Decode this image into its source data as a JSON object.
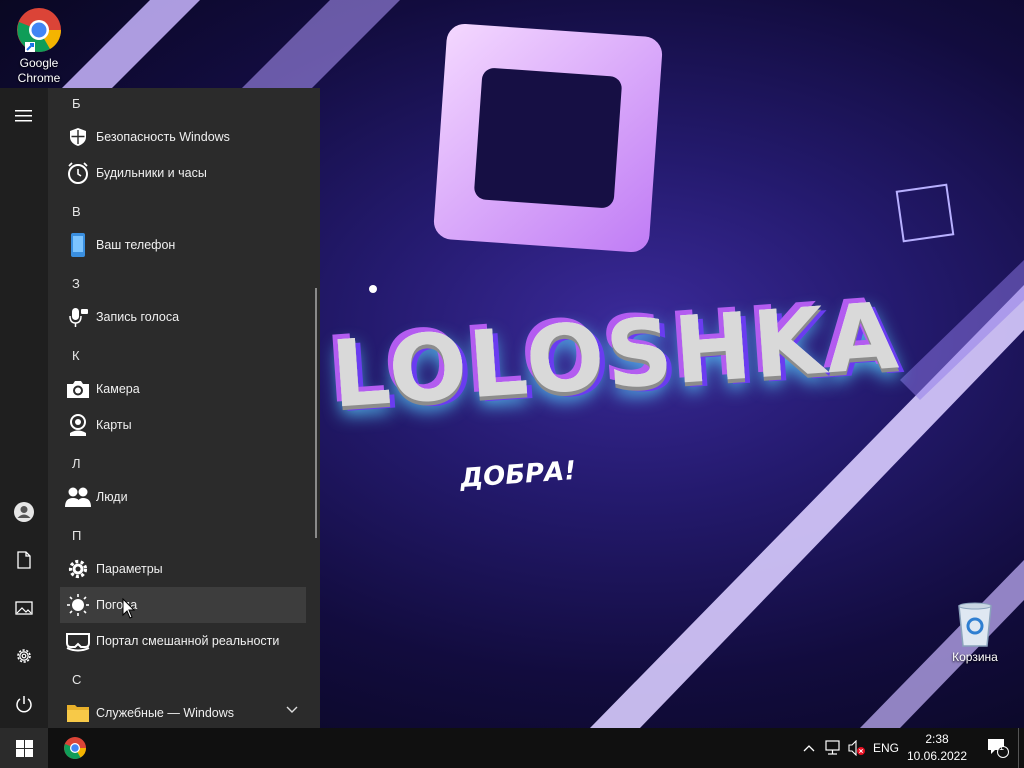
{
  "desktop": {
    "wallpaper_title": "LOLOSHKA",
    "wallpaper_subtitle": "ДОБРА!",
    "icons": [
      {
        "label": "Google\nChrome",
        "icon": "chrome-icon"
      },
      {
        "label": "Корзина",
        "icon": "recycle-bin-icon"
      }
    ]
  },
  "start_menu": {
    "rail": [
      {
        "name": "expand",
        "icon": "hamburger-icon"
      },
      {
        "name": "account",
        "icon": "user-icon"
      },
      {
        "name": "documents",
        "icon": "document-icon"
      },
      {
        "name": "pictures",
        "icon": "picture-icon"
      },
      {
        "name": "settings",
        "icon": "gear-icon"
      },
      {
        "name": "power",
        "icon": "power-icon"
      }
    ],
    "groups": [
      {
        "letter": "Б",
        "apps": [
          {
            "label": "Безопасность Windows",
            "icon": "shield-icon"
          },
          {
            "label": "Будильники и часы",
            "icon": "alarm-clock-icon"
          }
        ]
      },
      {
        "letter": "В",
        "apps": [
          {
            "label": "Ваш телефон",
            "icon": "phone-icon"
          }
        ]
      },
      {
        "letter": "З",
        "apps": [
          {
            "label": "Запись голоса",
            "icon": "microphone-icon"
          }
        ]
      },
      {
        "letter": "К",
        "apps": [
          {
            "label": "Камера",
            "icon": "camera-icon"
          },
          {
            "label": "Карты",
            "icon": "map-pin-icon"
          }
        ]
      },
      {
        "letter": "Л",
        "apps": [
          {
            "label": "Люди",
            "icon": "people-icon"
          }
        ]
      },
      {
        "letter": "П",
        "apps": [
          {
            "label": "Параметры",
            "icon": "gear-icon"
          },
          {
            "label": "Погода",
            "icon": "sun-icon"
          },
          {
            "label": "Портал смешанной реальности",
            "icon": "mixed-reality-icon"
          }
        ]
      },
      {
        "letter": "С",
        "apps": [
          {
            "label": "Служебные — Windows",
            "icon": "folder-icon"
          }
        ]
      }
    ]
  },
  "taskbar": {
    "language": "ENG",
    "time": "2:38",
    "date": "10.06.2022",
    "notification_count": "1"
  },
  "colors": {
    "start_bg": "#2b2b2b",
    "rail_bg": "#1f1f1f",
    "taskbar_bg": "#101010",
    "hover_bg": "#3d3d3d"
  }
}
